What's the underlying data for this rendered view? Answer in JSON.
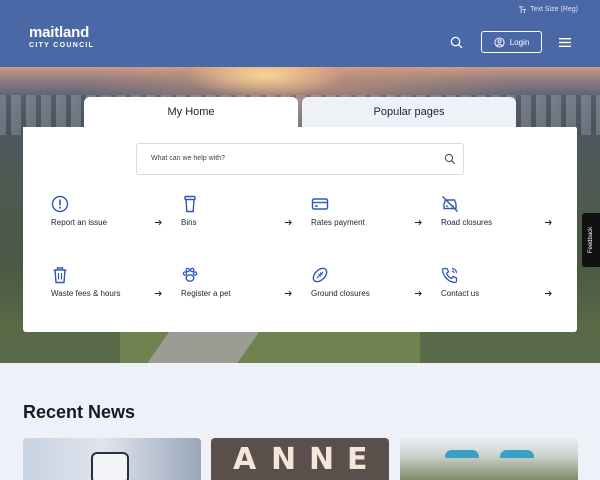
{
  "header": {
    "text_size_label": "Text Size (Reg)",
    "logo_main": "maitland",
    "logo_sub": "CITY COUNCIL",
    "login_label": "Login"
  },
  "tabs": [
    {
      "label": "My Home",
      "active": true
    },
    {
      "label": "Popular pages",
      "active": false
    }
  ],
  "search": {
    "placeholder": "What can we help with?"
  },
  "quick_links": [
    {
      "label": "Report an issue",
      "icon": "alert-icon"
    },
    {
      "label": "Bins",
      "icon": "bin-icon"
    },
    {
      "label": "Rates payment",
      "icon": "card-icon"
    },
    {
      "label": "Road closures",
      "icon": "car-off-icon"
    },
    {
      "label": "Waste fees & hours",
      "icon": "trash-icon"
    },
    {
      "label": "Register a pet",
      "icon": "paw-icon"
    },
    {
      "label": "Ground closures",
      "icon": "football-icon"
    },
    {
      "label": "Contact us",
      "icon": "phone-icon"
    }
  ],
  "feedback_label": "Feedback",
  "news": {
    "title": "Recent News",
    "quilt_letters": [
      "A",
      "N",
      "N",
      "E"
    ]
  },
  "colors": {
    "header": "#4a68a6",
    "accent": "#2f58b7"
  }
}
